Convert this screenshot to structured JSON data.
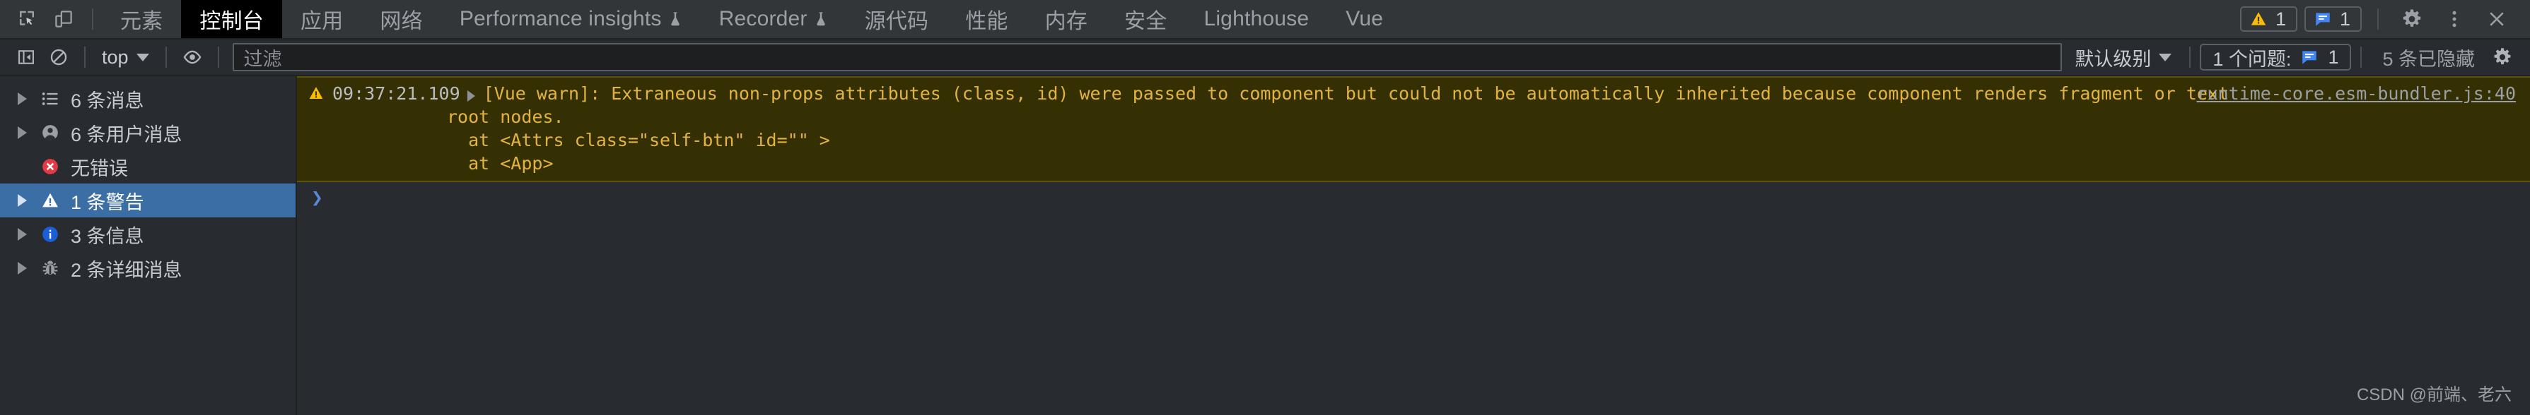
{
  "window": {
    "watermark": "CSDN @前端、老六"
  },
  "tabbar": {
    "inspect_icon": "inspect-element-icon",
    "device_icon": "device-toolbar-icon",
    "tabs": [
      {
        "label": "元素",
        "active": false,
        "experimental": false
      },
      {
        "label": "控制台",
        "active": true,
        "experimental": false
      },
      {
        "label": "应用",
        "active": false,
        "experimental": false
      },
      {
        "label": "网络",
        "active": false,
        "experimental": false
      },
      {
        "label": "Performance insights",
        "active": false,
        "experimental": true
      },
      {
        "label": "Recorder",
        "active": false,
        "experimental": true
      },
      {
        "label": "源代码",
        "active": false,
        "experimental": false
      },
      {
        "label": "性能",
        "active": false,
        "experimental": false
      },
      {
        "label": "内存",
        "active": false,
        "experimental": false
      },
      {
        "label": "安全",
        "active": false,
        "experimental": false
      },
      {
        "label": "Lighthouse",
        "active": false,
        "experimental": false
      },
      {
        "label": "Vue",
        "active": false,
        "experimental": false
      }
    ],
    "warning_badge": {
      "icon": "warning-triangle-icon",
      "count": "1",
      "color": "#fbbc04"
    },
    "message_badge": {
      "icon": "message-bubble-icon",
      "count": "1",
      "color": "#4285f4"
    },
    "settings_icon": "gear-icon",
    "more_icon": "kebab-menu-icon",
    "close_icon": "close-icon"
  },
  "console_toolbar": {
    "sidebar_toggle_icon": "show-console-sidebar-icon",
    "clear_icon": "clear-console-icon",
    "context_selector": "top",
    "eye_icon": "create-live-expression-icon",
    "filter": {
      "placeholder": "过滤",
      "value": ""
    },
    "level_selector": "默认级别",
    "issues": {
      "label": "1 个问题:",
      "icon": "message-bubble-icon",
      "count": "1"
    },
    "hidden_label": "5 条已隐藏",
    "settings_icon": "gear-icon"
  },
  "sidebar": {
    "items": [
      {
        "label": "6 条消息",
        "icon": "list-icon",
        "expandable": true,
        "selected": false
      },
      {
        "label": "6 条用户消息",
        "icon": "user-icon",
        "expandable": true,
        "selected": false
      },
      {
        "label": "无错误",
        "icon": "error-circle-icon",
        "expandable": false,
        "selected": false
      },
      {
        "label": "1 条警告",
        "icon": "warning-triangle-icon",
        "expandable": true,
        "selected": true
      },
      {
        "label": "3 条信息",
        "icon": "info-circle-icon",
        "expandable": true,
        "selected": false
      },
      {
        "label": "2 条详细消息",
        "icon": "bug-icon",
        "expandable": true,
        "selected": false
      }
    ]
  },
  "console": {
    "warning": {
      "level_icon": "warning-triangle-icon",
      "timestamp": "09:37:21.109",
      "message_line1": "[Vue warn]: Extraneous non-props attributes (class, id) were passed to component but could not be automatically inherited because component renders fragment or text",
      "message_line2": "root nodes.",
      "message_line3": "  at <Attrs class=\"self-btn\" id=\"\" >",
      "message_line4": "  at <App>",
      "source_link": "runtime-core.esm-bundler.js:40"
    },
    "prompt": {
      "chevron": "❯",
      "value": ""
    }
  },
  "colors": {
    "warning_bg": "#353004",
    "warning_border": "#5c5408",
    "warning_text": "#e2b341",
    "selection_blue": "#3b6ea5",
    "accent_blue": "#4285f4",
    "warning_yellow": "#fbbc04",
    "error_red": "#e63946",
    "toolbar_bg": "#323639",
    "panel_bg": "#282b2f"
  }
}
